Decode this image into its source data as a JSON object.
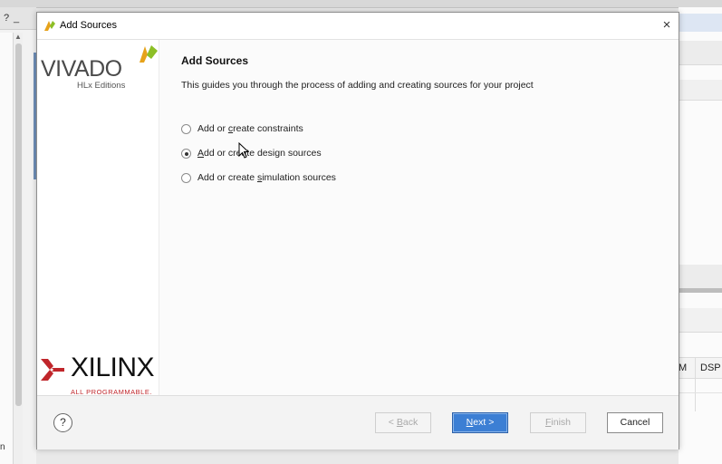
{
  "background": {
    "left_header_text": "?",
    "left_minimize": "_",
    "left_truncated_text": "n",
    "grid_header": [
      "M",
      "DSP"
    ]
  },
  "dialog": {
    "title": "Add Sources",
    "close_glyph": "×",
    "branding": {
      "product": "VIVADO",
      "edition": "HLx Editions",
      "vendor": "XILINX",
      "vendor_tagline": "ALL PROGRAMMABLE."
    },
    "heading": "Add Sources",
    "description": "This guides you through the process of adding and creating sources for your project",
    "options": [
      {
        "pre": "Add or ",
        "mnemonic": "c",
        "post": "reate constraints",
        "selected": false
      },
      {
        "pre": "",
        "mnemonic": "A",
        "post": "dd or create design sources",
        "selected": true
      },
      {
        "pre": "Add or create ",
        "mnemonic": "s",
        "post": "imulation sources",
        "selected": false
      }
    ],
    "help_glyph": "?",
    "buttons": {
      "back": {
        "pre": "< ",
        "mnemonic": "B",
        "post": "ack"
      },
      "next": {
        "pre": "",
        "mnemonic": "N",
        "post": "ext >"
      },
      "finish": {
        "pre": "",
        "mnemonic": "F",
        "post": "inish"
      },
      "cancel": "Cancel"
    },
    "colors": {
      "primary_button": "#3c7fd4",
      "vivado_leaf": "#8cbf26",
      "xilinx_red": "#c0262b"
    }
  }
}
